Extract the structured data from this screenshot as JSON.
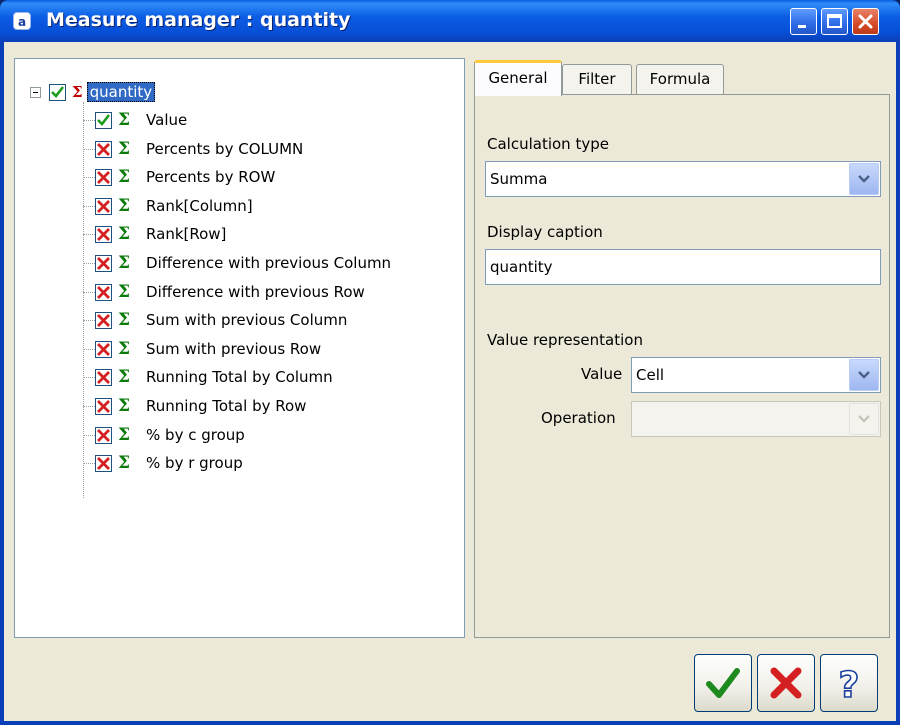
{
  "window": {
    "title": "Measure manager : quantity",
    "icon_letter": "a"
  },
  "tree": {
    "root": {
      "label": "quantity",
      "checked": true
    },
    "items": [
      {
        "label": "Value",
        "checked": true
      },
      {
        "label": "Percents by COLUMN",
        "checked": false
      },
      {
        "label": "Percents by ROW",
        "checked": false
      },
      {
        "label": "Rank[Column]",
        "checked": false
      },
      {
        "label": "Rank[Row]",
        "checked": false
      },
      {
        "label": "Difference with previous Column",
        "checked": false
      },
      {
        "label": "Difference with previous Row",
        "checked": false
      },
      {
        "label": "Sum with previous Column",
        "checked": false
      },
      {
        "label": "Sum with previous Row",
        "checked": false
      },
      {
        "label": "Running Total by Column",
        "checked": false
      },
      {
        "label": "Running Total by Row",
        "checked": false
      },
      {
        "label": "% by c group",
        "checked": false
      },
      {
        "label": "% by r group",
        "checked": false
      }
    ]
  },
  "tabs": [
    {
      "label": "General",
      "active": true
    },
    {
      "label": "Filter",
      "active": false
    },
    {
      "label": "Formula",
      "active": false
    }
  ],
  "general": {
    "calc_type_label": "Calculation type",
    "calc_type_value": "Summa",
    "display_caption_label": "Display caption",
    "display_caption_value": "quantity",
    "value_repr_label": "Value representation",
    "value_label": "Value",
    "value_value": "Cell",
    "operation_label": "Operation",
    "operation_value": ""
  },
  "colors": {
    "title_bar": "#0A5BE0",
    "check_green": "#1C9C1C",
    "cross_red": "#D42020",
    "sigma_green": "#0A7A0A",
    "selection": "#316AC5"
  },
  "icons": {
    "ok": "checkmark-icon",
    "cancel": "cross-icon",
    "help": "question-icon"
  }
}
